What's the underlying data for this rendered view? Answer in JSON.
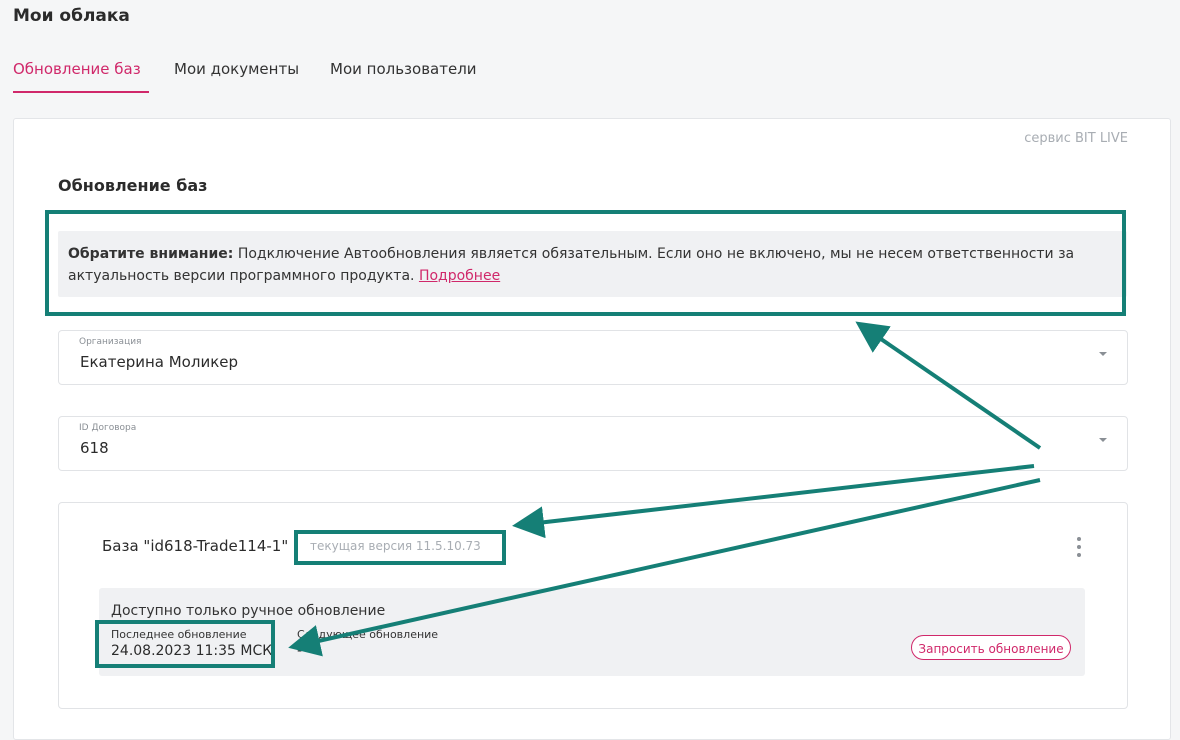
{
  "page": {
    "title": "Мои облака"
  },
  "tabs": [
    {
      "label": "Обновление баз",
      "active": true
    },
    {
      "label": "Мои документы",
      "active": false
    },
    {
      "label": "Мои пользователи",
      "active": false
    }
  ],
  "card": {
    "service_label": "сервис BIT LIVE",
    "section_title": "Обновление баз",
    "notice": {
      "bold": "Обратите внимание:",
      "text": " Подключение Автообновления является обязательным. Если оно не включено, мы не несем ответственности за актуальность версии программного продукта. ",
      "link": "Подробнее"
    },
    "organization": {
      "label": "Организация",
      "value": "Екатерина Моликер"
    },
    "contract": {
      "label": "ID Договора",
      "value": "618"
    },
    "base": {
      "name": "База \"id618-Trade114-1\"",
      "version": "текущая версия 11.5.10.73",
      "manual_text": "Доступно только ручное обновление",
      "last_update_label": "Последнее обновление",
      "last_update_value": "24.08.2023 11:35 МСК",
      "next_update_label": "Следующее обновление",
      "next_update_value": "-",
      "request_button": "Запросить обновление"
    }
  },
  "colors": {
    "accent": "#d0286a",
    "annotation": "#157f76"
  }
}
